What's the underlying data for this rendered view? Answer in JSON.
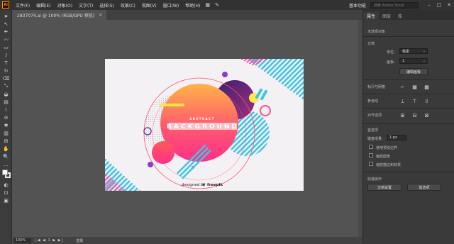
{
  "app": {
    "logo_text": "Ai"
  },
  "menu": [
    "文件(F)",
    "编辑(E)",
    "对象(O)",
    "文字(T)",
    "选择(S)",
    "效果(C)",
    "视图(V)",
    "窗口(W)",
    "帮助(H)"
  ],
  "window": {
    "workspace": "基本功能",
    "search_placeholder": "搜索 Adobe Stock"
  },
  "document": {
    "tab_label": "2837074.ai @ 100% (RGB/GPU 预览)"
  },
  "artwork": {
    "top_label": "ABSTRACT",
    "title": "BACKGROUND",
    "credit": "designed by",
    "brand": "freepik"
  },
  "status": {
    "zoom": "100%",
    "nav": "|◀ ◀ 1 ▶ ▶|",
    "mode": "选择"
  },
  "panel": {
    "tabs": [
      "属性",
      "图层",
      "库"
    ],
    "no_selection": "未选择对象",
    "doc_section": "文档",
    "unit_label": "单位:",
    "unit_value": "像素",
    "artboard_label": "画板:",
    "artboard_value": "1",
    "edit_artboard_button": "编辑画板",
    "ruler_grid": "标尺与网格",
    "guides": "参考线",
    "align": "对齐选项",
    "preferences": "首选项",
    "keyboard_increment_label": "键盘增量:",
    "keyboard_increment_value": "1 px",
    "opt_preview_bounds": "使用预览边界",
    "opt_scale_corners": "缩放圆角",
    "opt_scale_strokes": "缩放描边和效果",
    "quick_actions": "快速操作",
    "doc_setup_button": "文档设置",
    "preferences_button": "首选项"
  },
  "colors": {
    "accent_pink": "#ff2e7a",
    "accent_orange": "#ff9a3c",
    "accent_purple": "#5b2a86",
    "accent_cyan": "#3ec5e6",
    "accent_yellow": "#ffe84a"
  }
}
